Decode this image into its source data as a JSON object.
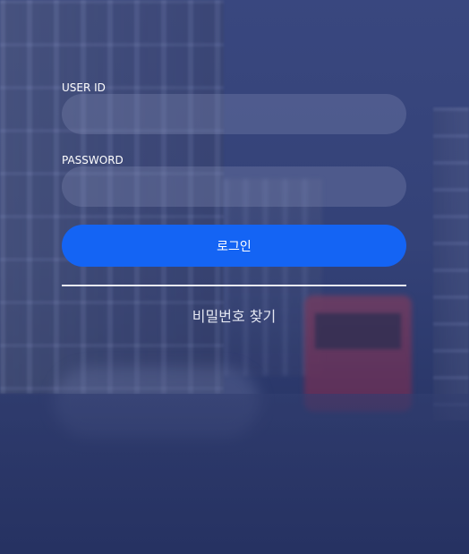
{
  "login_form": {
    "userid_label": "USER ID",
    "userid_value": "",
    "password_label": "PASSWORD",
    "password_value": "",
    "login_button_label": "로그인",
    "find_password_link": "비밀번호 찾기"
  },
  "colors": {
    "overlay": "#2f3d72",
    "login_button": "#1464f4",
    "text": "#ffffff"
  }
}
